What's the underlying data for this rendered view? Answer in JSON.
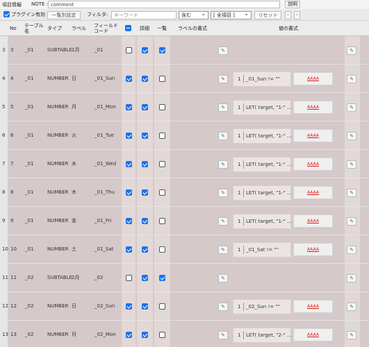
{
  "toolbar": {
    "item_info_label": "項目情報",
    "note_label": "NOTE :",
    "note_value": "comment",
    "help_label": "説明",
    "plugin_enabled_label": "プラグイン有効",
    "list_settings_label": "一覧別設定",
    "filter_label": "フィルタ:",
    "filter_placeholder": "キーワード",
    "match_select": "含む",
    "scope_select": "[ 全項目 ]",
    "reset_label": "リセット",
    "prev_label": "‹",
    "next_label": "›"
  },
  "columns": {
    "no": "No",
    "table_name": "テーブル名",
    "type": "タイプ",
    "label": "ラベル",
    "field_code": "フィールドコード",
    "detail": "詳細",
    "list": "一覧",
    "label_format": "ラベルの書式",
    "value_format": "値の書式"
  },
  "colors": {
    "accent": "#1a73e8",
    "row_bg": "#d5c9c9",
    "link_red": "#e01b1b"
  },
  "rows": [
    {
      "idx": "3",
      "no": "3",
      "table": "_01",
      "type": "SUBTABLE",
      "label": "1月",
      "code": "_01",
      "c1": false,
      "c2": true,
      "c3": true,
      "fmt_num": "",
      "fmt_text": "",
      "aaaa": ""
    },
    {
      "idx": "4",
      "no": "4",
      "table": "_01",
      "type": "NUMBER",
      "label": "日",
      "code": "_01_Sun",
      "c1": true,
      "c2": true,
      "c3": false,
      "fmt_num": "1",
      "fmt_text": "_01_Sun != \"\"",
      "aaaa": "AAAA"
    },
    {
      "idx": "5",
      "no": "5",
      "table": "_01",
      "type": "NUMBER",
      "label": "月",
      "code": "_01_Mon",
      "c1": true,
      "c2": true,
      "c3": false,
      "fmt_num": "1",
      "fmt_text": "LET( target, \"1-\" …",
      "aaaa": "AAAA"
    },
    {
      "idx": "6",
      "no": "6",
      "table": "_01",
      "type": "NUMBER",
      "label": "火",
      "code": "_01_Tue",
      "c1": true,
      "c2": true,
      "c3": false,
      "fmt_num": "1",
      "fmt_text": "LET( target, \"1-\" …",
      "aaaa": "AAAA"
    },
    {
      "idx": "7",
      "no": "7",
      "table": "_01",
      "type": "NUMBER",
      "label": "水",
      "code": "_01_Wed",
      "c1": true,
      "c2": true,
      "c3": false,
      "fmt_num": "1",
      "fmt_text": "LET( target, \"1-\" …",
      "aaaa": "AAAA"
    },
    {
      "idx": "8",
      "no": "8",
      "table": "_01",
      "type": "NUMBER",
      "label": "木",
      "code": "_01_Thu",
      "c1": true,
      "c2": true,
      "c3": false,
      "fmt_num": "1",
      "fmt_text": "LET( target, \"1-\" …",
      "aaaa": "AAAA"
    },
    {
      "idx": "9",
      "no": "9",
      "table": "_01",
      "type": "NUMBER",
      "label": "金",
      "code": "_01_Fri",
      "c1": true,
      "c2": true,
      "c3": false,
      "fmt_num": "1",
      "fmt_text": "LET( target, \"1-\" …",
      "aaaa": "AAAA"
    },
    {
      "idx": "10",
      "no": "10",
      "table": "_01",
      "type": "NUMBER",
      "label": "土",
      "code": "_01_Sat",
      "c1": true,
      "c2": true,
      "c3": false,
      "fmt_num": "1",
      "fmt_text": "_01_Sat != \"\"",
      "aaaa": "AAAA"
    },
    {
      "idx": "11",
      "no": "11",
      "table": "_02",
      "type": "SUBTABLE",
      "label": "2月",
      "code": "_02",
      "c1": false,
      "c2": true,
      "c3": true,
      "fmt_num": "",
      "fmt_text": "",
      "aaaa": ""
    },
    {
      "idx": "12",
      "no": "12",
      "table": "_02",
      "type": "NUMBER",
      "label": "日",
      "code": "_02_Sun",
      "c1": true,
      "c2": true,
      "c3": false,
      "fmt_num": "1",
      "fmt_text": "_02_Sun != \"\"",
      "aaaa": "AAAA"
    },
    {
      "idx": "13",
      "no": "13",
      "table": "_02",
      "type": "NUMBER",
      "label": "月",
      "code": "_02_Mon",
      "c1": true,
      "c2": true,
      "c3": false,
      "fmt_num": "1",
      "fmt_text": "LET( target, \"2-\" …",
      "aaaa": "AAAA"
    }
  ]
}
